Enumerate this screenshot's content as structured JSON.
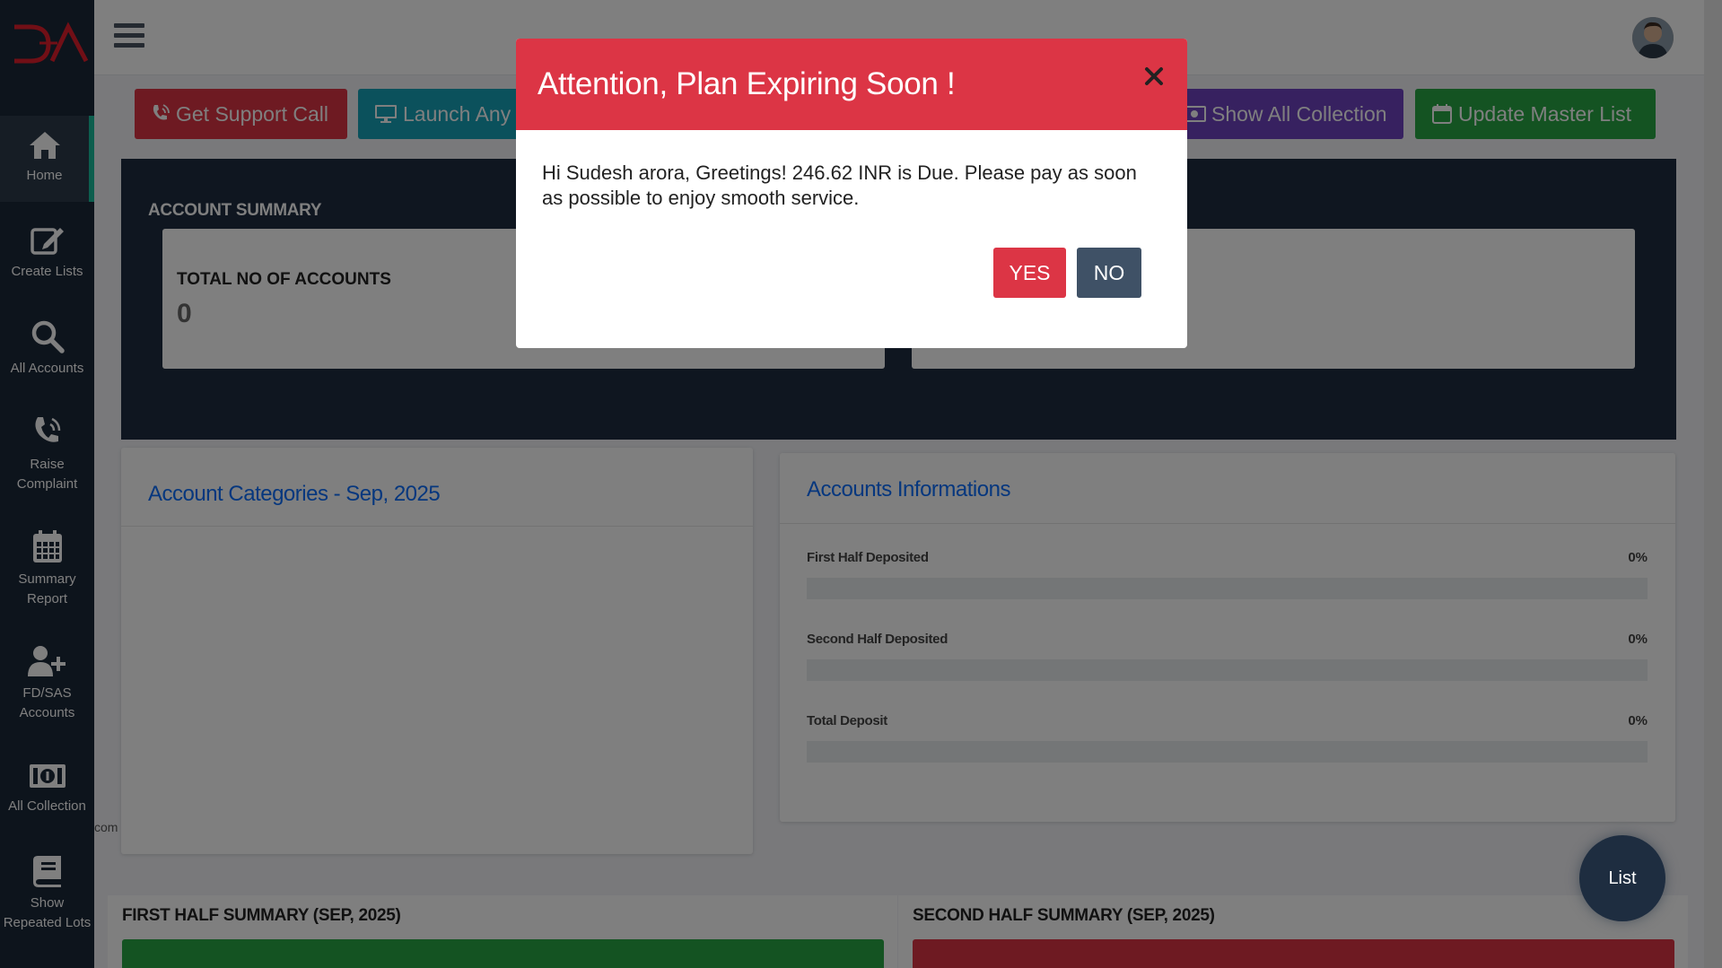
{
  "sidebar": {
    "items": [
      {
        "label": "Home"
      },
      {
        "label": "Create Lists"
      },
      {
        "label": "All Accounts"
      },
      {
        "label": "Raise Complaint"
      },
      {
        "label": "Summary Report"
      },
      {
        "label": "FD/SAS Accounts"
      },
      {
        "label": "All Collection"
      },
      {
        "label": "Show Repeated Lots"
      }
    ]
  },
  "toolbar": {
    "support_label": "Get Support Call",
    "launch_label": "Launch Any",
    "show_collection_label": "Show All Collection",
    "update_master_label": "Update Master List"
  },
  "summary": {
    "title": "ACCOUNT SUMMARY",
    "total_accounts_label": "TOTAL NO OF ACCOUNTS",
    "total_accounts_value": "0"
  },
  "categories_panel": {
    "title": "Account Categories - Sep, 2025"
  },
  "accounts_info": {
    "title": "Accounts Informations",
    "rows": [
      {
        "label": "First Half Deposited",
        "percent": "0%",
        "value": 0
      },
      {
        "label": "Second Half Deposited",
        "percent": "0%",
        "value": 0
      },
      {
        "label": "Total Deposit",
        "percent": "0%",
        "value": 0
      }
    ]
  },
  "cut_text": "com",
  "first_half": {
    "title": "FIRST HALF SUMMARY (SEP, 2025)"
  },
  "second_half": {
    "title": "SECOND HALF SUMMARY (SEP, 2025)"
  },
  "fab": {
    "label": "List"
  },
  "modal": {
    "title": "Attention, Plan Expiring Soon !",
    "body": "Hi Sudesh arora, Greetings! 246.62 INR is Due. Please pay as soon as possible to enjoy smooth service.",
    "yes_label": "YES",
    "no_label": "NO"
  },
  "colors": {
    "sidebar": "#1b2838",
    "danger": "#dc3545",
    "teal": "#17a2b8",
    "purple": "#6f42c1",
    "green": "#28a745",
    "dark_panel": "#1e2d40",
    "link_blue": "#0d6efd",
    "active_accent": "#1abc9c"
  }
}
